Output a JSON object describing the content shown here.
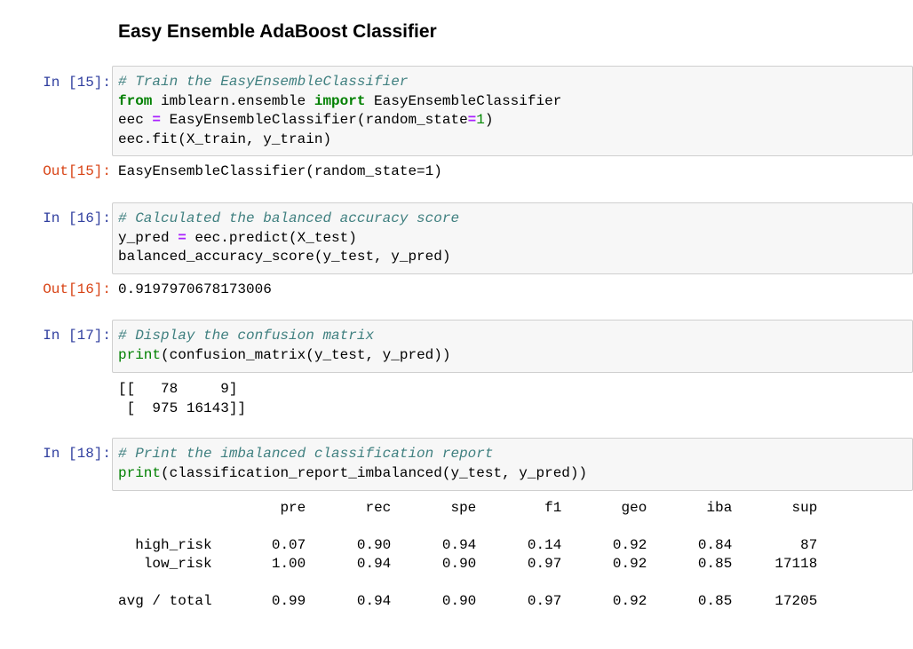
{
  "heading": "Easy Ensemble AdaBoost Classifier",
  "cells": [
    {
      "in_prompt": "In [15]:",
      "code": [
        [
          [
            "c",
            "# Train the EasyEnsembleClassifier"
          ]
        ],
        [
          [
            "k",
            "from"
          ],
          [
            "t",
            " imblearn.ensemble "
          ],
          [
            "k",
            "import"
          ],
          [
            "t",
            " EasyEnsembleClassifier"
          ]
        ],
        [
          [
            "t",
            "eec "
          ],
          [
            "o",
            "="
          ],
          [
            "t",
            " EasyEnsembleClassifier(random_state"
          ],
          [
            "o",
            "="
          ],
          [
            "n",
            "1"
          ],
          [
            "t",
            ")"
          ]
        ],
        [
          [
            "t",
            "eec.fit(X_train, y_train)"
          ]
        ]
      ],
      "out_prompt": "Out[15]:",
      "output": "EasyEnsembleClassifier(random_state=1)"
    },
    {
      "in_prompt": "In [16]:",
      "code": [
        [
          [
            "c",
            "# Calculated the balanced accuracy score"
          ]
        ],
        [
          [
            "t",
            "y_pred "
          ],
          [
            "o",
            "="
          ],
          [
            "t",
            " eec.predict(X_test)"
          ]
        ],
        [
          [
            "t",
            "balanced_accuracy_score(y_test, y_pred)"
          ]
        ]
      ],
      "out_prompt": "Out[16]:",
      "output": "0.9197970678173006"
    },
    {
      "in_prompt": "In [17]:",
      "code": [
        [
          [
            "c",
            "# Display the confusion matrix"
          ]
        ],
        [
          [
            "b",
            "print"
          ],
          [
            "t",
            "(confusion_matrix(y_test, y_pred))"
          ]
        ]
      ],
      "out_prompt": "",
      "output": "[[   78     9]\n [  975 16143]]"
    },
    {
      "in_prompt": "In [18]:",
      "code": [
        [
          [
            "c",
            "# Print the imbalanced classification report"
          ]
        ],
        [
          [
            "b",
            "print"
          ],
          [
            "t",
            "(classification_report_imbalanced(y_test, y_pred))"
          ]
        ]
      ],
      "out_prompt": "",
      "output": ""
    }
  ],
  "report": {
    "headers": [
      "pre",
      "rec",
      "spe",
      "f1",
      "geo",
      "iba",
      "sup"
    ],
    "rows": [
      {
        "label": "high_risk",
        "values": [
          "0.07",
          "0.90",
          "0.94",
          "0.14",
          "0.92",
          "0.84",
          "87"
        ]
      },
      {
        "label": "low_risk",
        "values": [
          "1.00",
          "0.94",
          "0.90",
          "0.97",
          "0.92",
          "0.85",
          "17118"
        ]
      }
    ],
    "total": {
      "label": "avg / total",
      "values": [
        "0.99",
        "0.94",
        "0.90",
        "0.97",
        "0.92",
        "0.85",
        "17205"
      ]
    }
  }
}
